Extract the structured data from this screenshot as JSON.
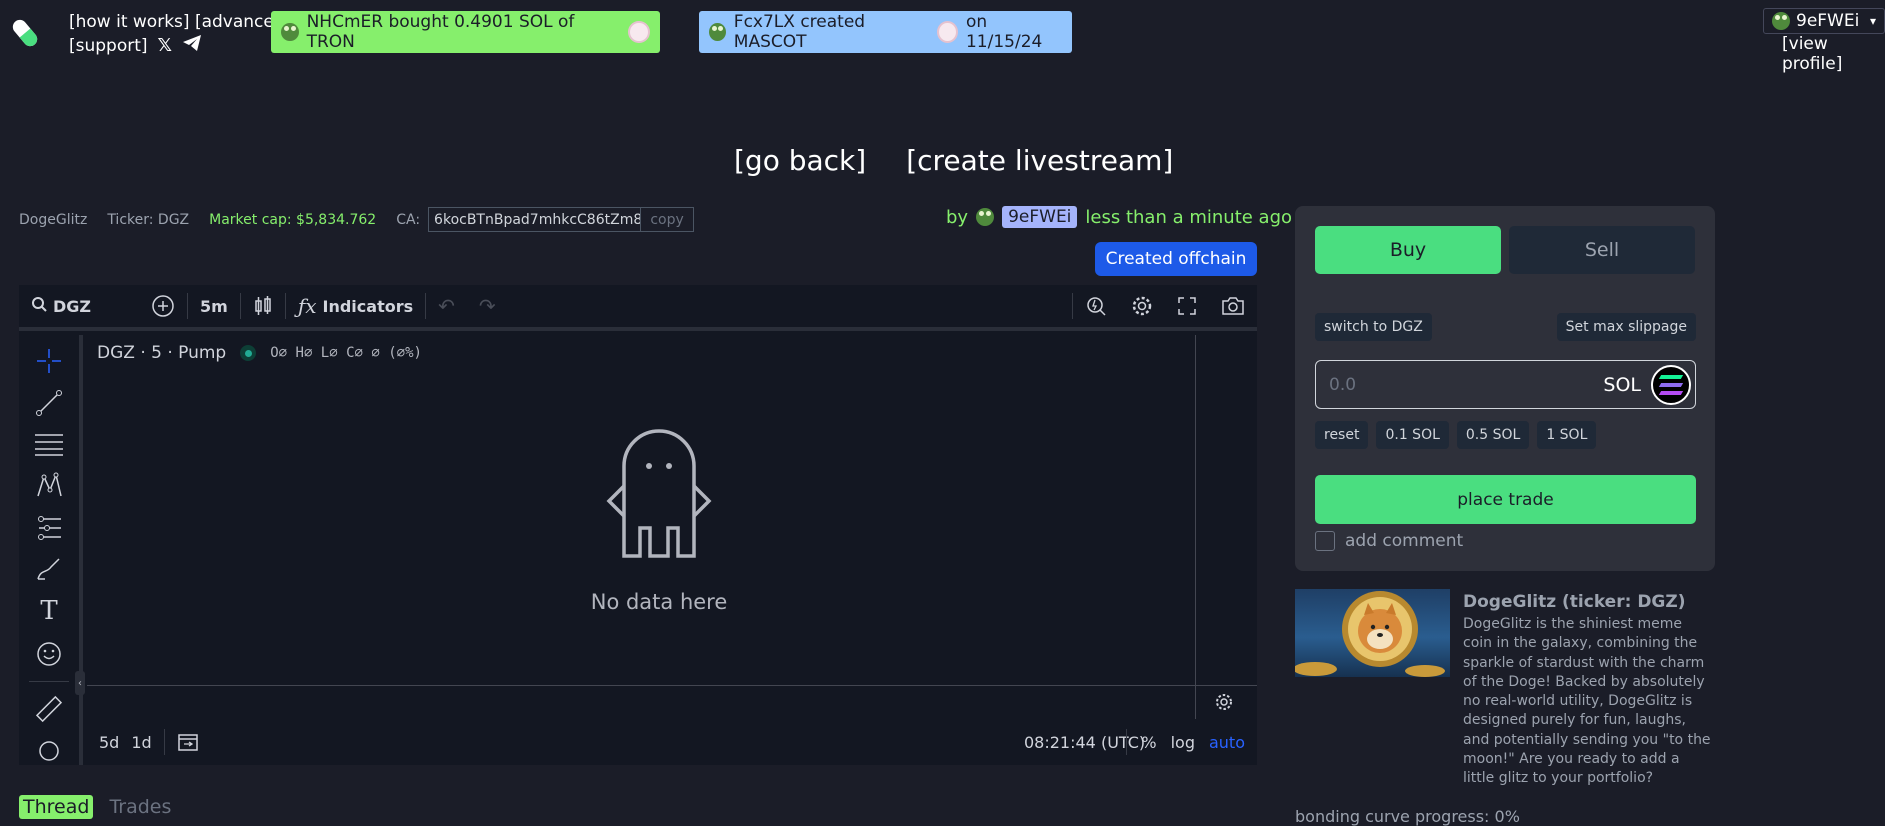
{
  "nav": {
    "how_it_works": "[how it works]",
    "advanced": "[advanced]",
    "support": "[support]"
  },
  "tickers": [
    {
      "text": "NHCmER  bought 0.4901 SOL of TRON"
    },
    {
      "text_a": "Fcx7LX created MASCOT",
      "text_b": "on 11/15/24"
    }
  ],
  "profile": {
    "name": "9eFWEi",
    "view_label": "[view profile]"
  },
  "center_links": {
    "go_back": "[go back]",
    "create_livestream": "[create livestream]"
  },
  "token": {
    "name": "DogeGlitz",
    "ticker": "Ticker: DGZ",
    "market_cap": "Market cap: $5,834.762",
    "ca_label": "CA:",
    "ca_value": "6kocBTnBpad7mhkcC86tZm8",
    "copy_label": "copy",
    "by_label": "by",
    "creator": "9eFWEi",
    "created_ago": "less than a minute ago",
    "offchain_label": "Created offchain"
  },
  "chart": {
    "symbol": "DGZ",
    "interval": "5m",
    "indicators_label": "Indicators",
    "legend_title": "DGZ · 5 · Pump",
    "ohlc": "O∅ H∅ L∅ C∅ ∅ (∅%)",
    "no_data": "No data here",
    "range_5d": "5d",
    "range_1d": "1d",
    "time": "08:21:44 (UTC)",
    "pct": "%",
    "log": "log",
    "auto": "auto"
  },
  "tabs": {
    "thread": "Thread",
    "trades": "Trades"
  },
  "trade": {
    "buy": "Buy",
    "sell": "Sell",
    "switch": "switch to DGZ",
    "slippage": "Set max slippage",
    "placeholder": "0.0",
    "currency": "SOL",
    "quick": [
      "reset",
      "0.1 SOL",
      "0.5 SOL",
      "1 SOL"
    ],
    "place": "place trade",
    "comment": "add comment"
  },
  "card": {
    "title": "DogeGlitz (ticker: DGZ)",
    "description": "DogeGlitz is the shiniest meme coin in the galaxy, combining the sparkle of stardust with the charm of the Doge! Backed by absolutely no real-world utility, DogeGlitz is designed purely for fun, laughs, and potentially sending you \"to the moon!\" Are you ready to add a little glitz to your portfolio?"
  },
  "bonding": "bonding curve progress: 0%",
  "colors": {
    "accent_green": "#86ef6c",
    "button_green": "#4ade80",
    "blue": "#1d5ae8"
  }
}
